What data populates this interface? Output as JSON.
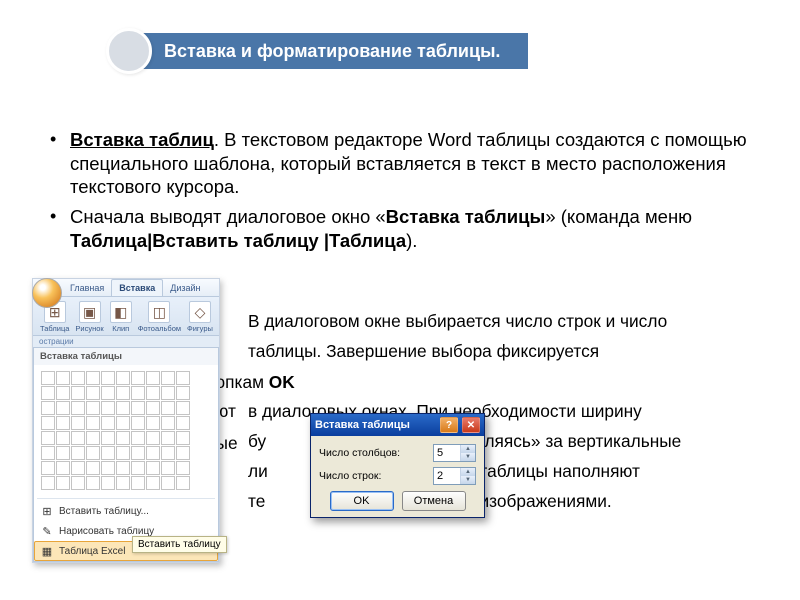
{
  "header": {
    "title": "Вставка и форматирование таблицы."
  },
  "body": {
    "bullet1_lead": "Вставка таблиц",
    "bullet1_rest": ".  В текстовом редакторе Word таблицы создаются с помощью специального шаблона, который вставляется в текст в место расположения текстового курсора.",
    "bullet2_a": "Сначала выводят диалоговое окно «",
    "bullet2_b": "Вставка таблицы",
    "bullet2_c": "» (команда меню ",
    "bullet2_d": "Таблица|Вставить таблицу |Таблица",
    "bullet2_e": ").",
    "para2_l1": "В диалоговом окне выбирается число строк и число",
    "para2_l2a": "таблицы.   Завершение выбора фиксируется",
    "para2_l2b": "нопкам ",
    "para2_l2c": "OK",
    "para2_l3a": "в диалоговых окнах.  При необходимости ширину",
    "para2_l3b": "яют",
    "para2_l4a": "бу",
    "para2_l4b": "цепляясь» за  вертикальные",
    "para2_l4c": "ные",
    "para2_l5a": "ли",
    "para2_l5b": "ки таблицы наполняют",
    "para2_l6": "ли изображениями.",
    "para2_l6a": "те"
  },
  "ribbon": {
    "tabs": [
      "Главная",
      "Вставка",
      "Дизайн"
    ],
    "items": [
      {
        "label": "Таблица",
        "icon": "⊞"
      },
      {
        "label": "Рисунок",
        "icon": "▣"
      },
      {
        "label": "Клип",
        "icon": "◧"
      },
      {
        "label": "Фотоальбом",
        "icon": "◫"
      },
      {
        "label": "Фигуры",
        "icon": "◇"
      }
    ],
    "group": "острации"
  },
  "popup": {
    "title": "Вставка таблицы",
    "items": [
      {
        "label": "Вставить таблицу...",
        "icon": "⊞"
      },
      {
        "label": "Нарисовать таблицу",
        "icon": "✎"
      },
      {
        "label": "Таблица Excel",
        "icon": "▦"
      }
    ],
    "tooltip": "Вставить таблицу"
  },
  "dialog": {
    "title": "Вставка таблицы",
    "cols_label": "Число столбцов:",
    "cols_value": "5",
    "rows_label": "Число строк:",
    "rows_value": "2",
    "ok": "OK",
    "cancel": "Отмена"
  }
}
